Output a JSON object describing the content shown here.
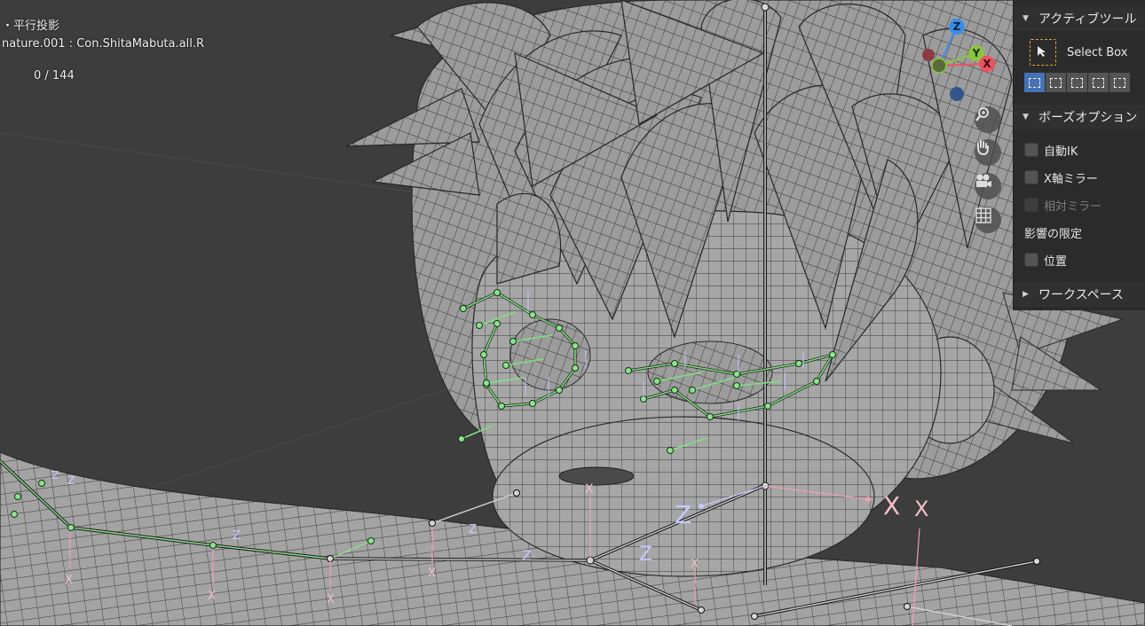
{
  "viewport": {
    "view_mode": "・平行投影",
    "active_bone": "nature.001 : Con.ShitaMabuta.all.R",
    "frame_count": "0 / 144",
    "axis_labels": {
      "z": "Z",
      "y": "Y",
      "x": "X"
    },
    "colors": {
      "background": "#3d3d3d",
      "mesh": "#a9a9a9",
      "wire": "#2a2a2a",
      "bone_green": "#6ee06e",
      "bone_line": "#e0e0e0",
      "axis_x": "#f05060",
      "axis_y": "#8cc63f",
      "axis_z": "#3b8ee6"
    }
  },
  "nav": {
    "zoom": "zoom-icon",
    "pan": "hand-icon",
    "camera": "camera-icon",
    "grid": "grid-icon"
  },
  "sidebar": {
    "active_tool": {
      "header": "アクティブツール",
      "tool_name": "Select Box"
    },
    "pose_options": {
      "header": "ボーズオプション",
      "auto_ik": "自動IK",
      "x_mirror": "X軸ミラー",
      "relative_mirror": "相対ミラー",
      "limit_label": "影響の限定",
      "location": "位置"
    },
    "workspace": {
      "header": "ワークスペース"
    }
  }
}
